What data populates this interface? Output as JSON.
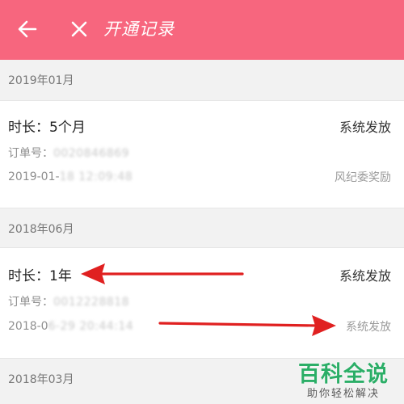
{
  "header": {
    "title": "开通记录",
    "background_color": "#f7667e",
    "back_icon": "arrow-left-icon",
    "close_icon": "close-icon"
  },
  "sections": [
    {
      "date": "2019年01月",
      "record": {
        "duration_label": "时长：",
        "duration_value": "5个月",
        "method": "系统发放",
        "order_label": "订单号：",
        "order_number_blurred": "0020846869",
        "timestamp_prefix": "2019-01-",
        "timestamp_blurred": "18 12:09:48",
        "note": "风纪委奖励"
      }
    },
    {
      "date": "2018年06月",
      "record": {
        "duration_label": "时长：",
        "duration_value": "1年",
        "method": "系统发放",
        "order_label": "订单号：",
        "order_number_blurred": "0012228818",
        "timestamp_prefix": "2018-0",
        "timestamp_blurred": "6-29 20:44:14",
        "note": "系统发放"
      }
    },
    {
      "date": "2018年03月"
    }
  ],
  "annotation_color": "#e02020",
  "watermark": {
    "main": "百科全说",
    "sub": "助你轻松解决",
    "color": "#2bae67"
  }
}
